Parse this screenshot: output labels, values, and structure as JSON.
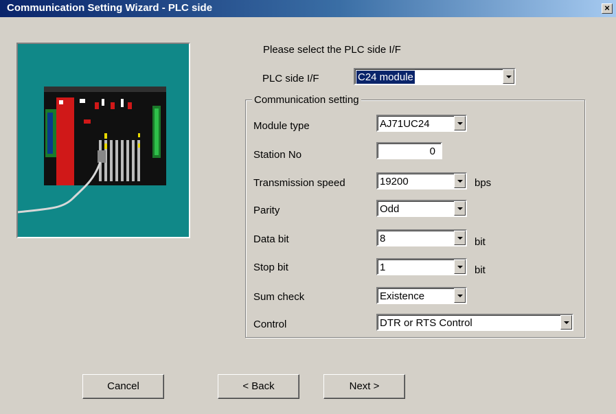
{
  "window": {
    "title": "Communication Setting Wizard - PLC side",
    "close_label": "×"
  },
  "prompt": "Please select the PLC side I/F",
  "plc_side_if": {
    "label": "PLC side I/F",
    "value": "C24 module"
  },
  "group": {
    "legend": "Communication setting",
    "module_type": {
      "label": "Module type",
      "value": "AJ71UC24"
    },
    "station_no": {
      "label": "Station No",
      "value": "0"
    },
    "transmission_speed": {
      "label": "Transmission speed",
      "value": "19200",
      "unit": "bps"
    },
    "parity": {
      "label": "Parity",
      "value": "Odd"
    },
    "data_bit": {
      "label": "Data bit",
      "value": "8",
      "unit": "bit"
    },
    "stop_bit": {
      "label": "Stop bit",
      "value": "1",
      "unit": "bit"
    },
    "sum_check": {
      "label": "Sum check",
      "value": "Existence"
    },
    "control": {
      "label": "Control",
      "value": "DTR or RTS Control"
    }
  },
  "buttons": {
    "cancel": "Cancel",
    "back": "< Back",
    "next": "Next >"
  },
  "colors": {
    "titlebar": "#0a246a",
    "picture_bg": "#108888",
    "dialog_bg": "#d4d0c8",
    "selection": "#0a246a"
  }
}
